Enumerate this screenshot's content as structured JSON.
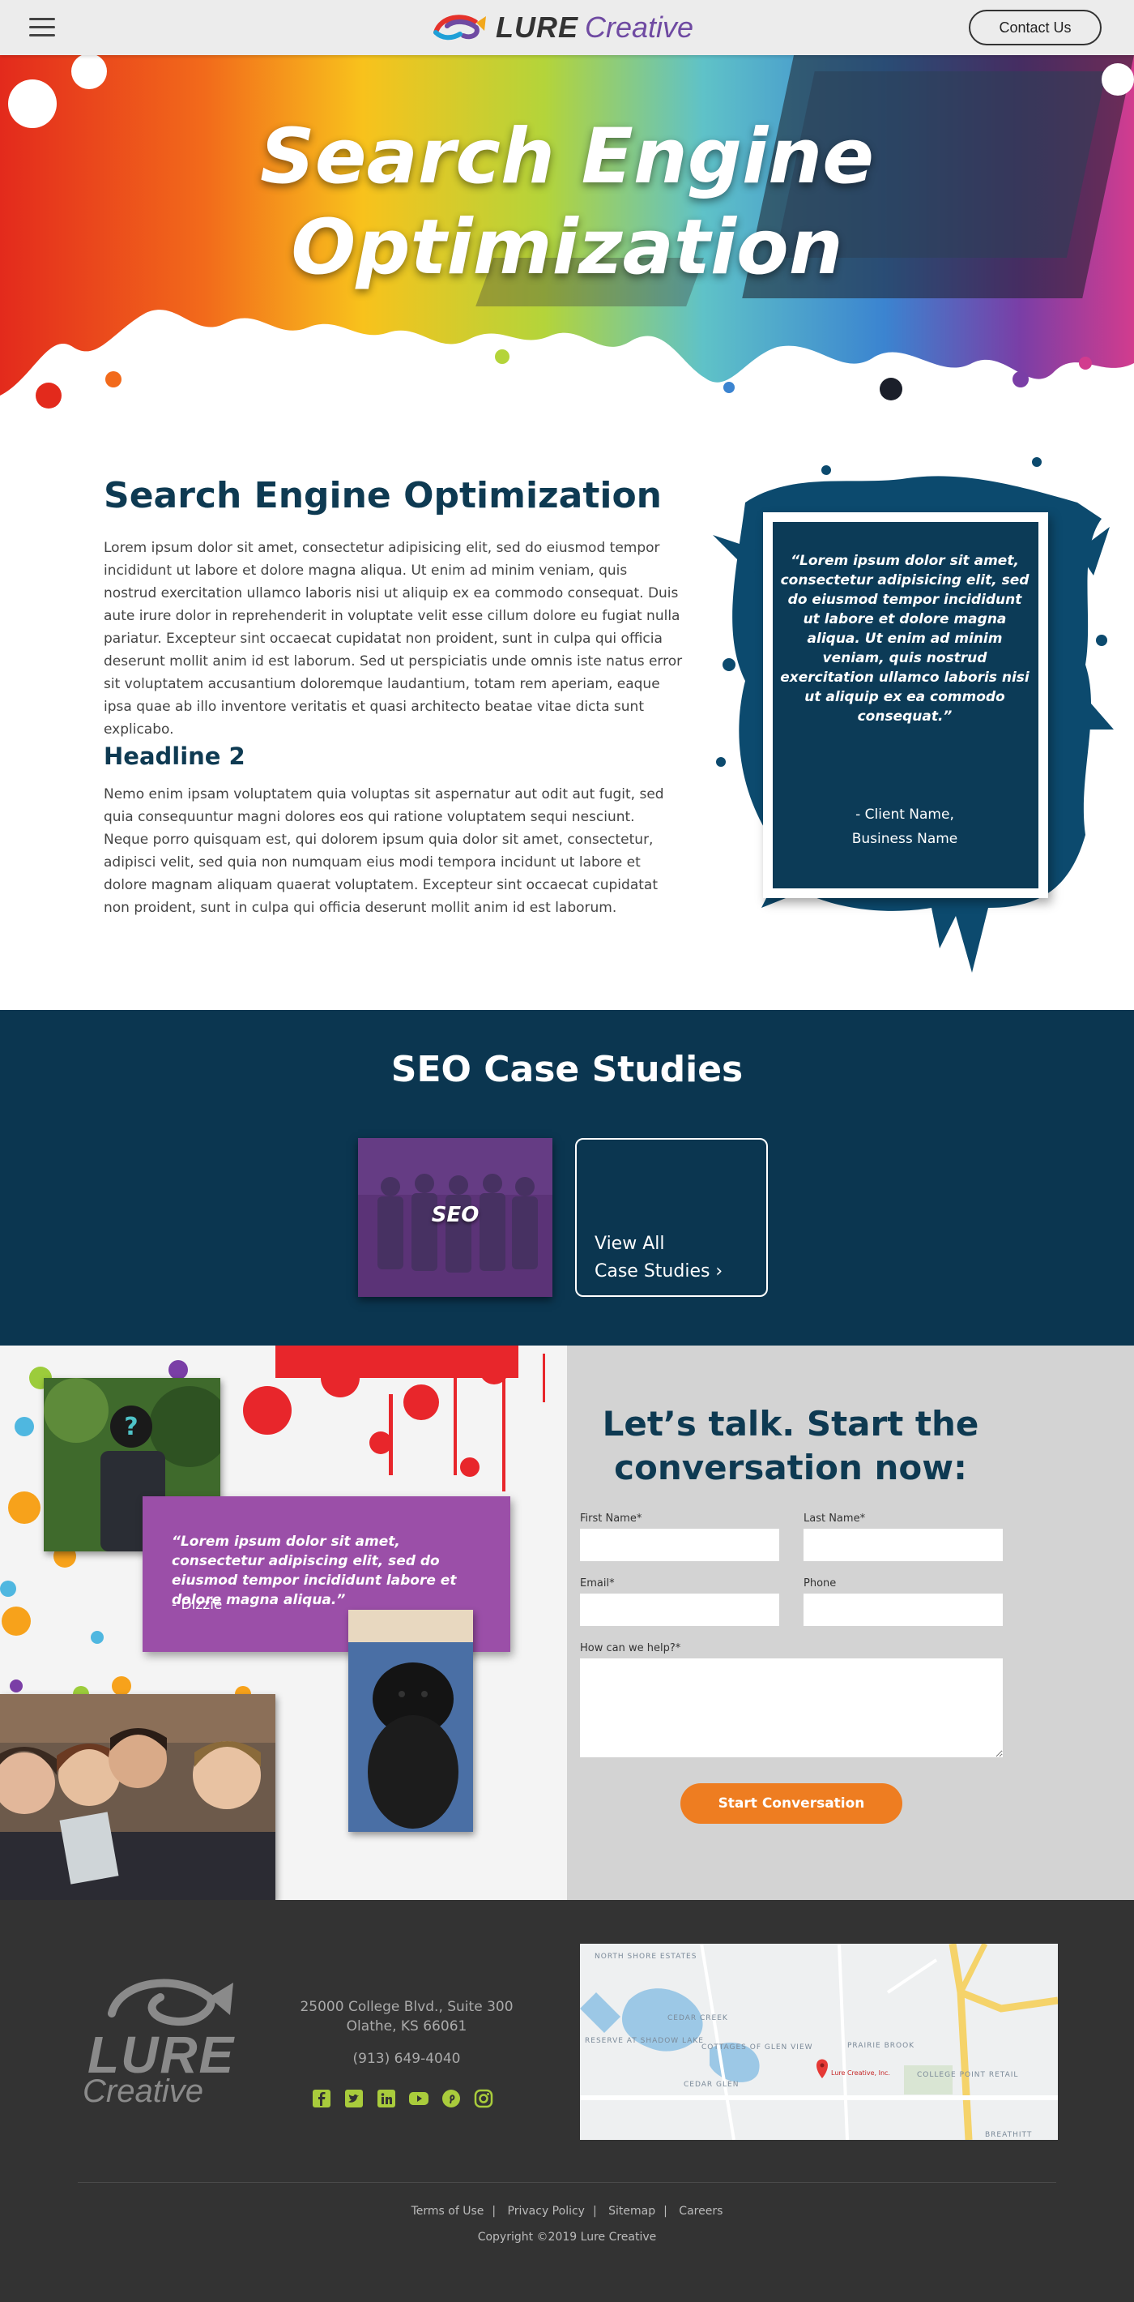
{
  "header": {
    "logo_lure": "LURE",
    "logo_creative": "Creative",
    "contact_label": "Contact Us"
  },
  "hero": {
    "title_line1": "Search Engine",
    "title_line2": "Optimization"
  },
  "content": {
    "heading": "Search Engine Optimization",
    "paragraph1": "Lorem ipsum dolor sit amet, consectetur adipisicing elit, sed do eiusmod tempor incididunt ut labore et dolore magna aliqua. Ut enim ad minim veniam, quis nostrud exercitation ullamco laboris nisi ut aliquip ex ea commodo consequat. Duis aute irure dolor in reprehenderit in voluptate velit esse cillum dolore eu fugiat nulla pariatur. Excepteur sint occaecat cupidatat non proident, sunt in culpa qui officia deserunt mollit anim id est laborum. Sed ut perspiciatis unde omnis iste natus error sit voluptatem accusantium doloremque laudantium, totam rem aperiam, eaque ipsa quae ab illo inventore veritatis et quasi architecto beatae vitae dicta sunt explicabo.",
    "headline2": "Headline 2",
    "paragraph2": "Nemo enim ipsam voluptatem quia voluptas sit aspernatur aut odit aut fugit, sed quia consequuntur magni dolores eos qui ratione voluptatem sequi nesciunt. Neque porro quisquam est, qui dolorem ipsum quia dolor sit amet, consectetur, adipisci velit, sed quia non numquam eius modi tempora incidunt ut labore et dolore magnam aliquam quaerat voluptatem. Excepteur sint occaecat cupidatat non proident, sunt in culpa qui officia deserunt mollit anim id est laborum.",
    "quote": "“Lorem ipsum dolor sit amet, consectetur adipisicing elit, sed do eiusmod tempor incididunt ut labore et dolore magna aliqua. Ut enim ad minim veniam, quis nostrud exercitation ullamco laboris nisi ut aliquip ex ea commodo consequat.”",
    "quote_name": "- Client Name,",
    "quote_business": "Business Name"
  },
  "case_studies": {
    "title": "SEO Case Studies",
    "card_label": "SEO",
    "view_all_line1": "View All",
    "view_all_line2": "Case Studies ›"
  },
  "talk": {
    "title": "Let’s talk. Start the conversation now:",
    "first_name": "First Name*",
    "last_name": "Last Name*",
    "email": "Email*",
    "phone": "Phone",
    "help": "How can we help?*",
    "submit": "Start Conversation",
    "testimonial": "“Lorem ipsum dolor sit amet, consectetur adipiscing elit, sed do eiusmod tempor incididunt labore et dolore magna aliqua.”",
    "testimonial_name": "- Dizzie"
  },
  "footer": {
    "logo_lure": "LURE",
    "logo_creative": "Creative",
    "address1": "25000 College Blvd., Suite 300",
    "address2": "Olathe, KS 66061",
    "phone": "(913) 649-4040",
    "social_icons": [
      "facebook-icon",
      "twitter-icon",
      "linkedin-icon",
      "youtube-icon",
      "pinterest-icon",
      "instagram-icon"
    ],
    "links": [
      "Terms of Use",
      "Privacy Policy",
      "Sitemap",
      "Careers"
    ],
    "copyright": "Copyright ©2019 Lure Creative",
    "map_labels": {
      "north_shore": "NORTH SHORE ESTATES",
      "cedar_creek": "CEDAR CREEK",
      "reserve": "RESERVE AT SHADOW LAKE",
      "cottages": "COTTAGES OF GLEN VIEW",
      "prairie_brook": "PRAIRIE BROOK",
      "cedar_glen": "CEDAR GLEN",
      "college_point": "COLLEGE POINT RETAIL",
      "breathitt": "BREATHITT",
      "pin": "Lure Creative, Inc."
    }
  },
  "colors": {
    "navy": "#0b3650",
    "heading": "#0e3a52",
    "purple": "#6f4aa2",
    "orange": "#ee7d21",
    "social_green": "#a9cc3c"
  }
}
